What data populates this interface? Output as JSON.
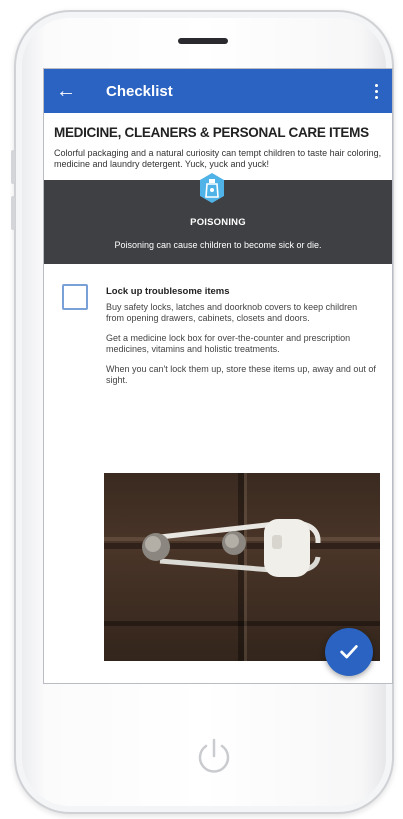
{
  "appbar": {
    "title": "Checklist",
    "back_icon": "arrow-back-icon",
    "menu_icon": "more-vertical-icon",
    "color": "#2a63c2"
  },
  "section": {
    "title": "MEDICINE, CLEANERS & PERSONAL CARE ITEMS",
    "description": "Colorful packaging and a natural curiosity can tempt children to taste hair coloring, medicine and laundry detergent. Yuck, yuck and yuck!"
  },
  "hazard": {
    "icon": "poison-bottle-icon",
    "title": "POISONING",
    "text": "Poisoning can cause children to become sick or die.",
    "band_color": "#3f4043",
    "icon_color": "#4fb3e8"
  },
  "item": {
    "title": "Lock up troublesome items",
    "checked": false,
    "paragraphs": [
      "Buy safety locks, latches and doorknob covers to keep children from opening drawers, cabinets, closets and doors.",
      "Get a medicine lock box for over-the-counter and prescription medicines, vitamins and holistic treatments.",
      "When you can't lock them up, store these items up, away and out of sight."
    ],
    "image": "cabinet-safety-latch-photo"
  },
  "fab": {
    "icon": "check-icon",
    "color": "#2a63c2"
  },
  "device": {
    "home_icon": "power-icon"
  }
}
